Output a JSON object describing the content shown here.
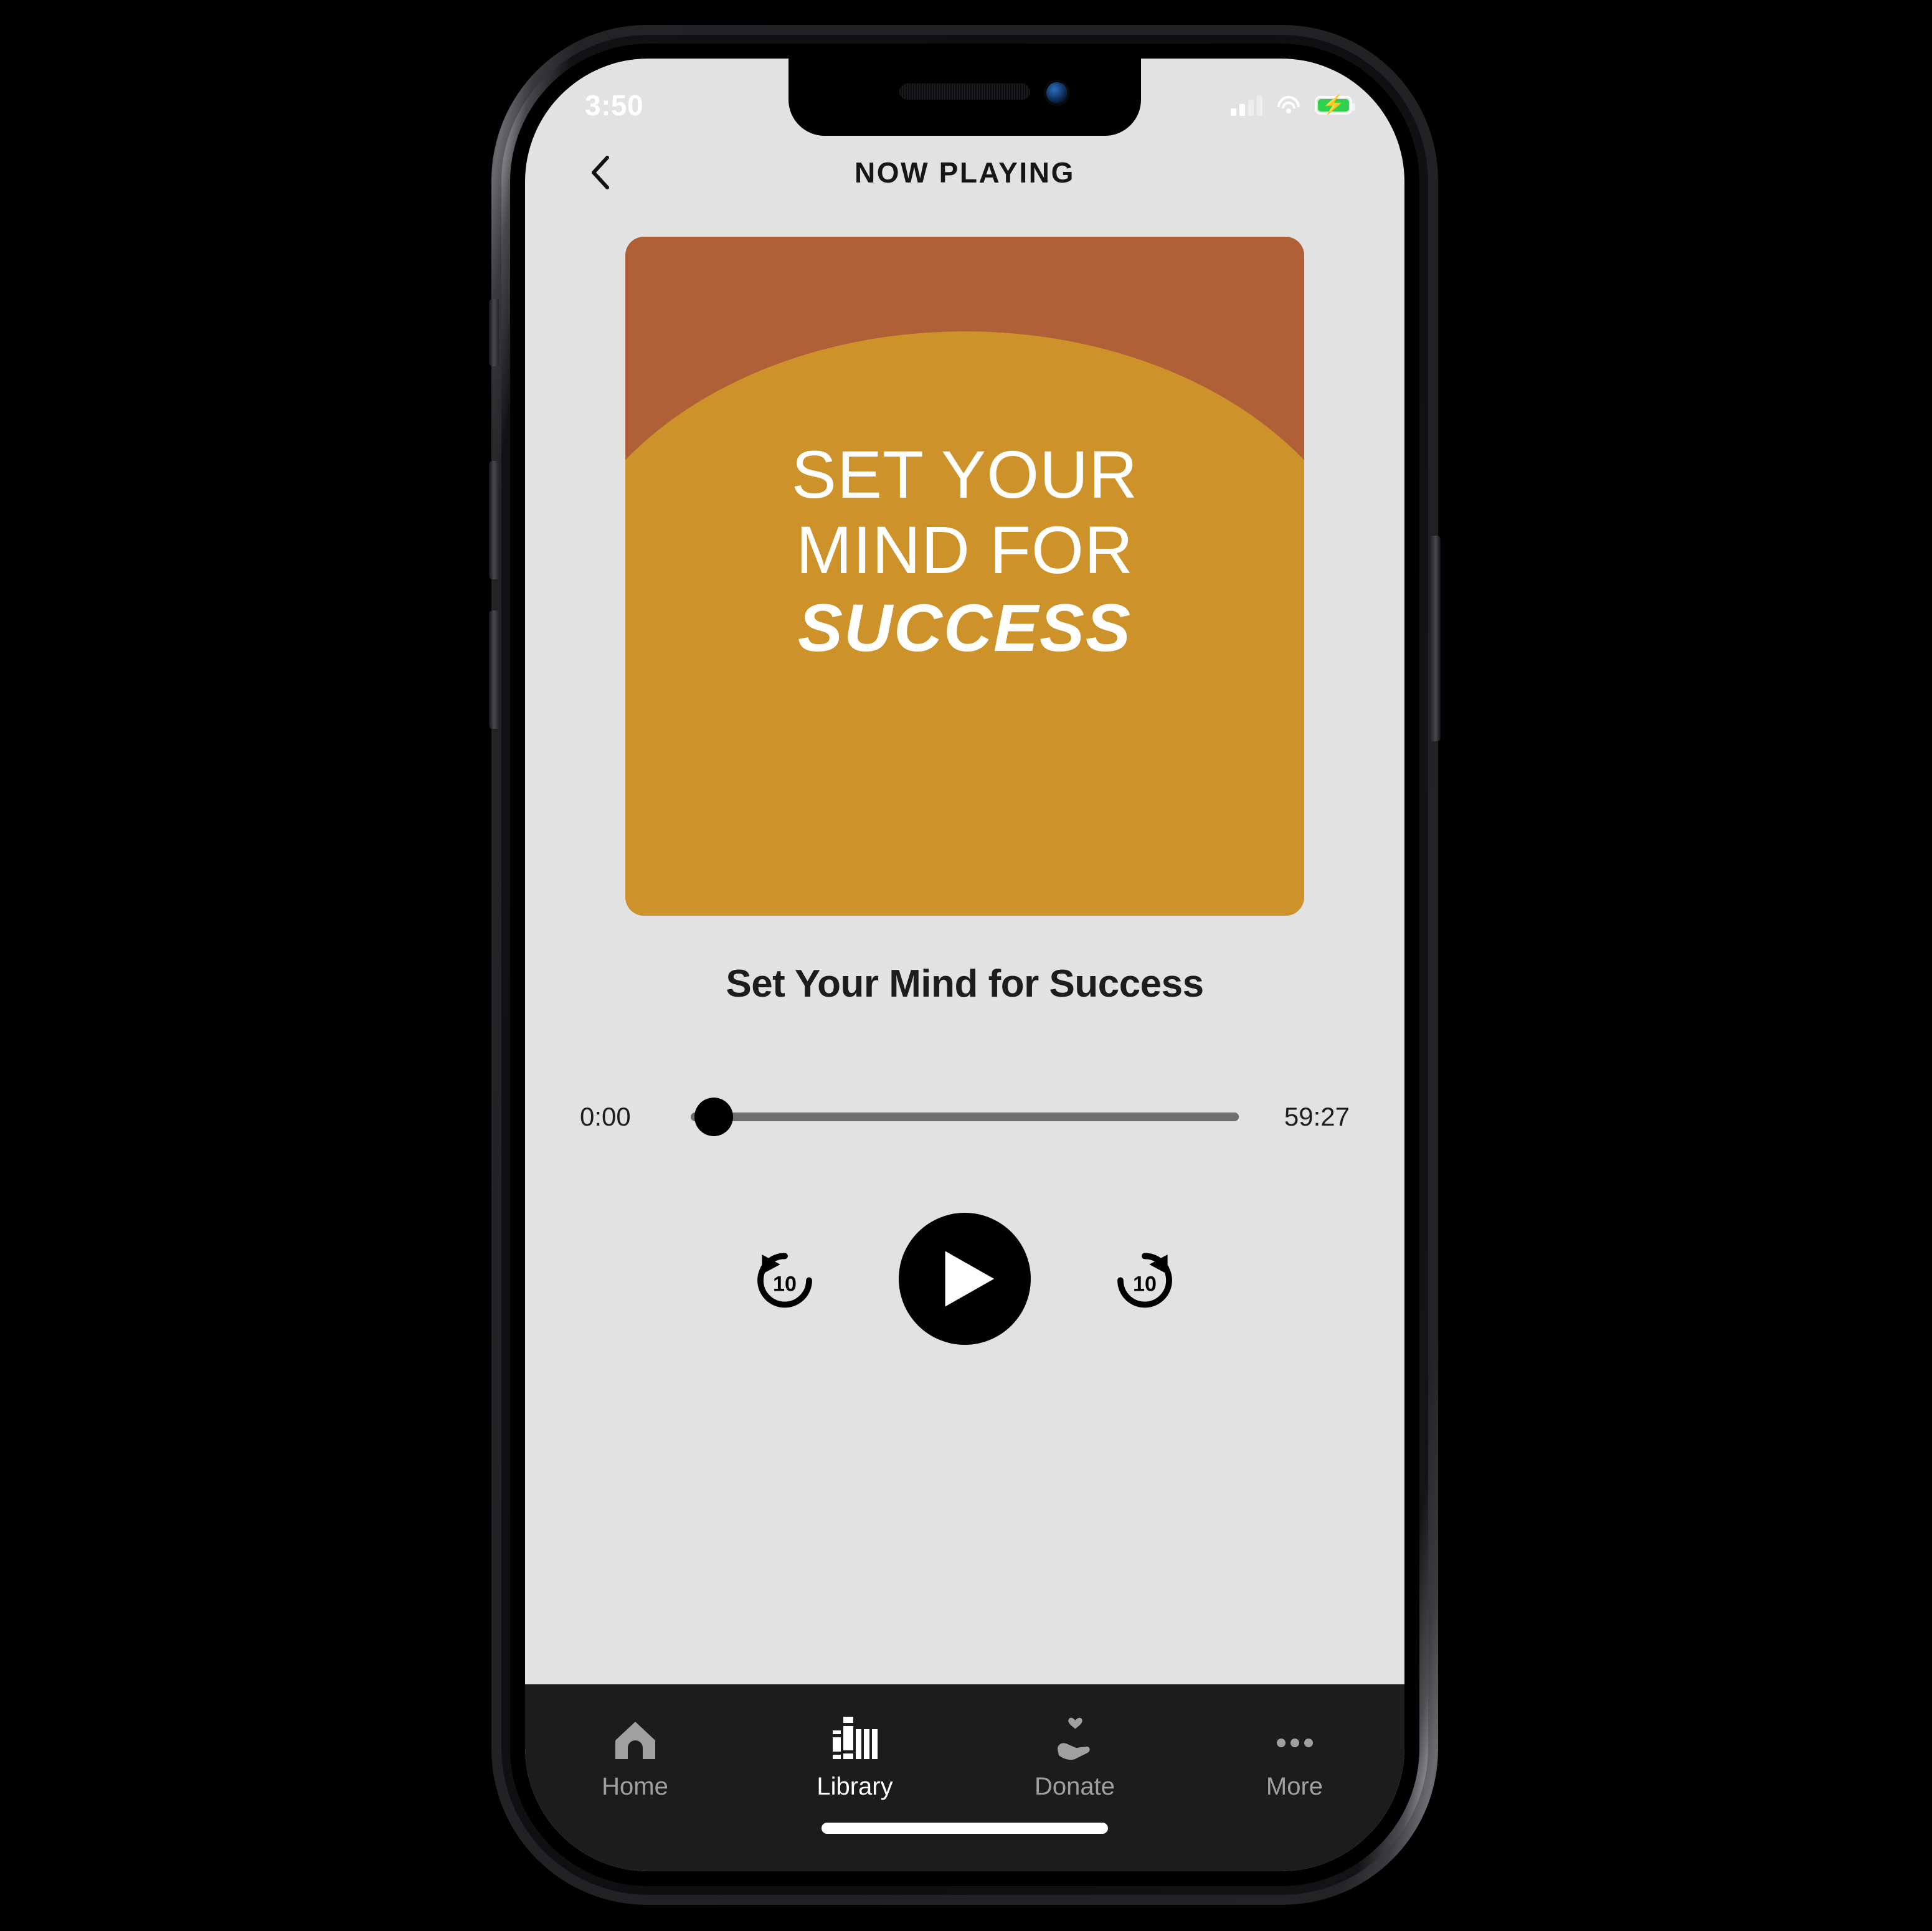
{
  "status_bar": {
    "time": "3:50",
    "signal_icon": "signal-bars-icon",
    "wifi_icon": "wifi-icon",
    "battery_icon": "battery-charging-icon",
    "battery_color": "#2FD14E"
  },
  "nav": {
    "title": "NOW PLAYING",
    "back_icon": "chevron-left-icon"
  },
  "artwork": {
    "line1": "SET YOUR",
    "line2": "MIND FOR",
    "line3": "SUCCESS",
    "background_color": "#B05F37",
    "arch_color": "#CE922A",
    "text_color": "#FFFFFF"
  },
  "player": {
    "track_title": "Set Your Mind for Success",
    "elapsed_time": "0:00",
    "total_time": "59:27",
    "progress_percent": 0,
    "skip_back_label": "10",
    "skip_forward_label": "10",
    "skip_back_icon": "rewind-10-icon",
    "play_icon": "play-icon",
    "skip_forward_icon": "forward-10-icon"
  },
  "tab_bar": {
    "background_color": "#1C1C1C",
    "active_color": "#FFFFFF",
    "inactive_color": "#A0A0A0",
    "items": [
      {
        "label": "Home",
        "icon": "home-icon",
        "active": false
      },
      {
        "label": "Library",
        "icon": "books-icon",
        "active": true
      },
      {
        "label": "Donate",
        "icon": "hand-heart-icon",
        "active": false
      },
      {
        "label": "More",
        "icon": "ellipsis-icon",
        "active": false
      }
    ]
  },
  "screen": {
    "background_color": "#E2E2E2"
  }
}
